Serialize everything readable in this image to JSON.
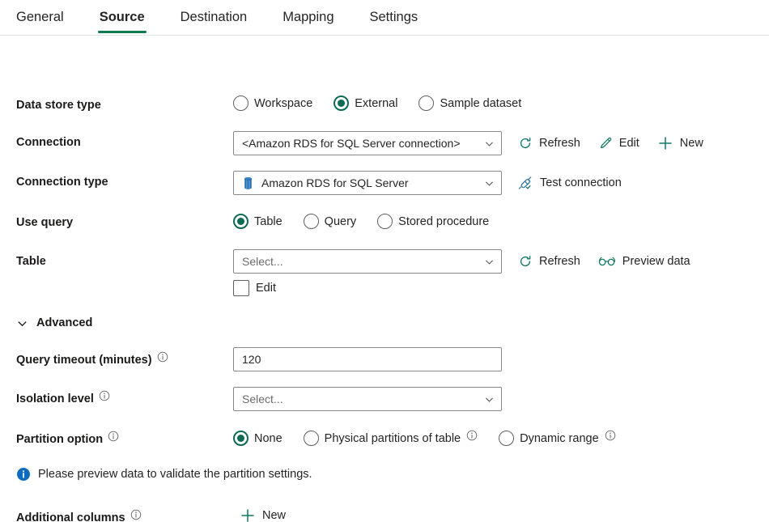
{
  "tabs": [
    {
      "label": "General",
      "active": false
    },
    {
      "label": "Source",
      "active": true
    },
    {
      "label": "Destination",
      "active": false
    },
    {
      "label": "Mapping",
      "active": false
    },
    {
      "label": "Settings",
      "active": false
    }
  ],
  "colors": {
    "accent_teal": "#0c6b55",
    "tab_underline": "#0f7a4f",
    "icon_teal": "#117865",
    "info_blue": "#0f6cbd",
    "aws_blue": "#2a72b5",
    "border": "#8a8886",
    "text": "#242424"
  },
  "form": {
    "data_store_type": {
      "label": "Data store type",
      "options": [
        {
          "label": "Workspace",
          "selected": false
        },
        {
          "label": "External",
          "selected": true
        },
        {
          "label": "Sample dataset",
          "selected": false
        }
      ]
    },
    "connection": {
      "label": "Connection",
      "value": "<Amazon RDS for SQL Server connection>",
      "commands": [
        {
          "label": "Refresh",
          "icon": "refresh-icon"
        },
        {
          "label": "Edit",
          "icon": "pencil-icon"
        },
        {
          "label": "New",
          "icon": "plus-icon"
        }
      ]
    },
    "connection_type": {
      "label": "Connection type",
      "value": "Amazon RDS for SQL Server",
      "lead_icon": "amazon-rds-icon",
      "commands": [
        {
          "label": "Test connection",
          "icon": "plug-check-icon"
        }
      ]
    },
    "use_query": {
      "label": "Use query",
      "options": [
        {
          "label": "Table",
          "selected": true
        },
        {
          "label": "Query",
          "selected": false
        },
        {
          "label": "Stored procedure",
          "selected": false
        }
      ]
    },
    "table": {
      "label": "Table",
      "placeholder": "Select...",
      "value": "",
      "commands": [
        {
          "label": "Refresh",
          "icon": "refresh-icon"
        },
        {
          "label": "Preview data",
          "icon": "glasses-icon"
        }
      ],
      "edit_checkbox": {
        "label": "Edit",
        "checked": false
      }
    },
    "advanced": {
      "label": "Advanced",
      "expanded": true
    },
    "query_timeout": {
      "label": "Query timeout (minutes)",
      "value": "120",
      "has_info": true
    },
    "isolation_level": {
      "label": "Isolation level",
      "placeholder": "Select...",
      "value": "",
      "has_info": true
    },
    "partition_option": {
      "label": "Partition option",
      "has_info": true,
      "options": [
        {
          "label": "None",
          "selected": true,
          "has_info": false
        },
        {
          "label": "Physical partitions of table",
          "selected": false,
          "has_info": true
        },
        {
          "label": "Dynamic range",
          "selected": false,
          "has_info": true
        }
      ]
    },
    "partition_message": "Please preview data to validate the partition settings.",
    "additional_columns": {
      "label": "Additional columns",
      "has_info": true,
      "commands": [
        {
          "label": "New",
          "icon": "plus-icon"
        }
      ]
    }
  }
}
